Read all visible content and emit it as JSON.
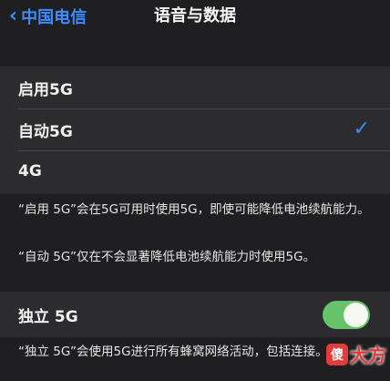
{
  "nav": {
    "back_label": "中国电信",
    "title": "语音与数据"
  },
  "mode_options": [
    {
      "label": "启用5G",
      "selected": false
    },
    {
      "label": "自动5G",
      "selected": true
    },
    {
      "label": "4G",
      "selected": false
    }
  ],
  "notes": {
    "enable_5g": "“启用 5G”会在5G可用时使用5G，即使可能降低电池续航能力。",
    "auto_5g": "“自动 5G”仅在不会显著降低电池续航能力时使用5G。",
    "standalone": "“独立 5G”会使用5G进行所有蜂窝网络活动，包括连接。"
  },
  "standalone": {
    "label": "独立 5G",
    "enabled": true
  },
  "watermark": {
    "badge": "傻",
    "text": "大方"
  },
  "colors": {
    "accent": "#3d8bff",
    "toggle_on": "#66c36a",
    "watermark": "#e23b3b"
  }
}
